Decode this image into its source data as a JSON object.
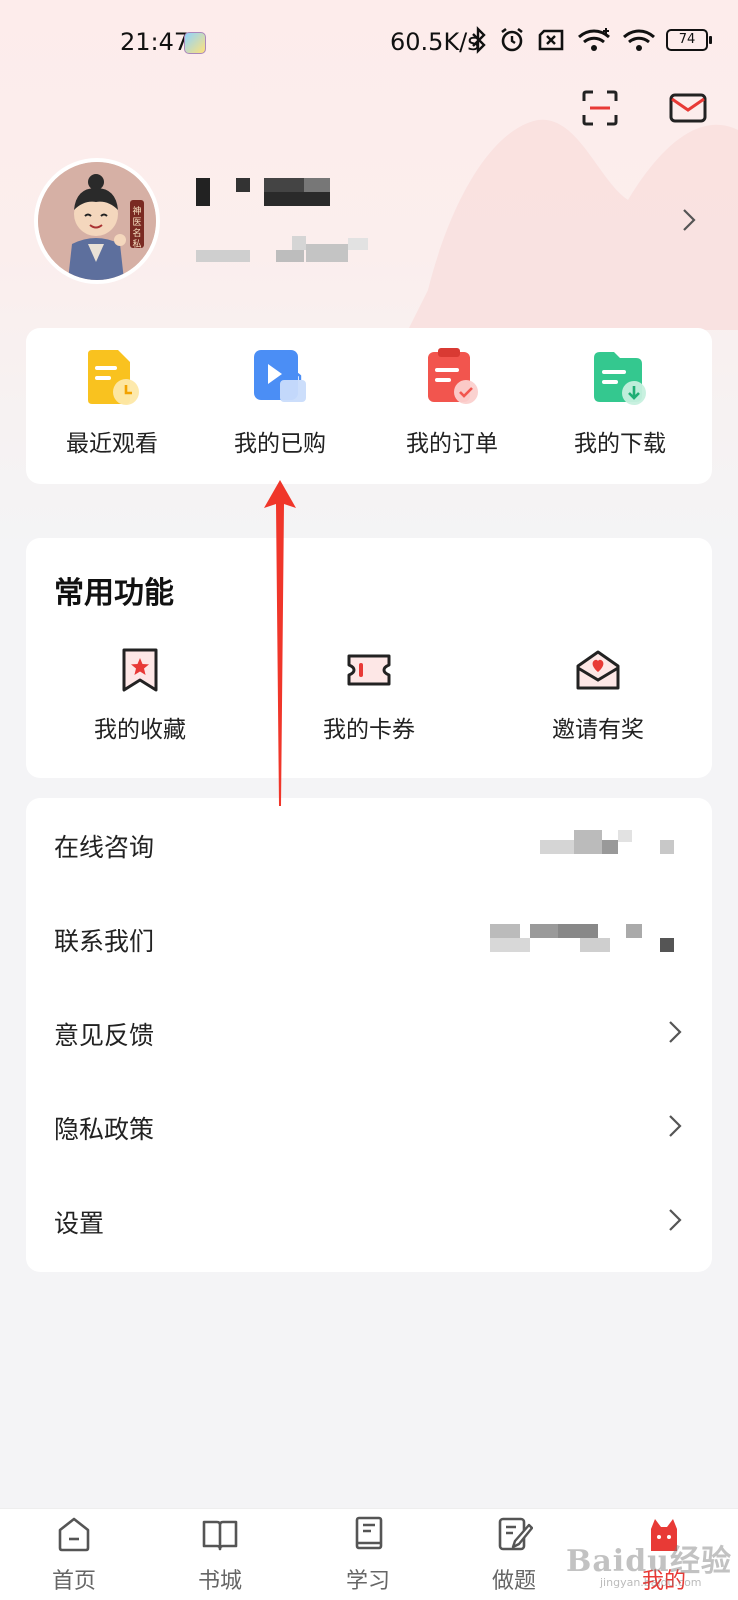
{
  "status_bar": {
    "time": "21:47",
    "network_speed": "60.5K/s",
    "battery": "74",
    "icons": [
      "bluetooth-icon",
      "alarm-icon",
      "sim-off-icon",
      "wifi-plus-icon",
      "wifi-icon",
      "battery-icon"
    ]
  },
  "header": {
    "scan_icon": "scan-icon",
    "message_icon": "mail-icon"
  },
  "profile": {
    "avatar_badge_text": "神医名私",
    "arrow_icon": "chevron-right-icon"
  },
  "quick_actions": [
    {
      "label": "最近观看",
      "icon": "recent-watch-icon",
      "color": "#f9b81f"
    },
    {
      "label": "我的已购",
      "icon": "purchased-icon",
      "color": "#4a90f5"
    },
    {
      "label": "我的订单",
      "icon": "orders-icon",
      "color": "#f0554f"
    },
    {
      "label": "我的下载",
      "icon": "download-icon",
      "color": "#32c58e"
    }
  ],
  "common_functions": {
    "title": "常用功能",
    "items": [
      {
        "label": "我的收藏",
        "icon": "favorites-icon"
      },
      {
        "label": "我的卡券",
        "icon": "coupon-icon"
      },
      {
        "label": "邀请有奖",
        "icon": "invite-icon"
      }
    ]
  },
  "menu_list": [
    {
      "label": "在线咨询",
      "has_value": true
    },
    {
      "label": "联系我们",
      "has_value": true
    },
    {
      "label": "意见反馈",
      "has_value": false
    },
    {
      "label": "隐私政策",
      "has_value": false
    },
    {
      "label": "设置",
      "has_value": false
    }
  ],
  "tabbar": {
    "items": [
      {
        "label": "首页",
        "icon": "home-icon",
        "active": false
      },
      {
        "label": "书城",
        "icon": "book-icon",
        "active": false
      },
      {
        "label": "学习",
        "icon": "study-icon",
        "active": false
      },
      {
        "label": "做题",
        "icon": "exercise-icon",
        "active": false
      },
      {
        "label": "我的",
        "icon": "mine-icon",
        "active": true
      }
    ]
  },
  "colors": {
    "accent": "#e83a36",
    "annotation_arrow": "#f0362a"
  },
  "watermark": {
    "text": "Baidu经验",
    "sub": "jingyan.baidu.com"
  }
}
